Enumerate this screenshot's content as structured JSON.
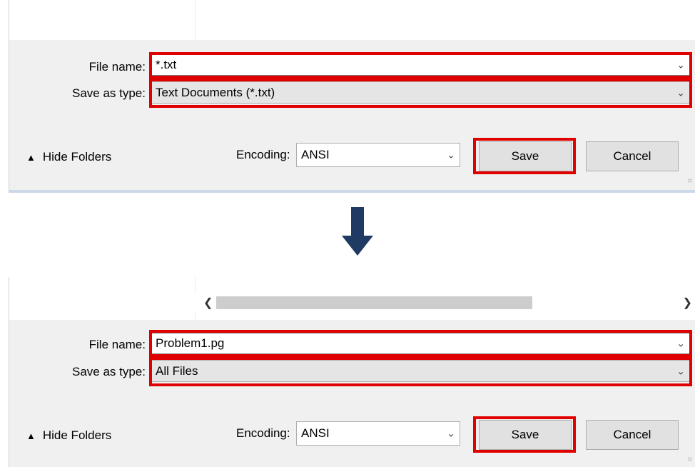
{
  "panels": [
    {
      "file_name_label": "File name:",
      "file_name_value": "*.txt",
      "save_as_type_label": "Save as type:",
      "save_as_type_value": "Text Documents (*.txt)",
      "hide_folders_label": "Hide Folders",
      "encoding_label": "Encoding:",
      "encoding_value": "ANSI",
      "save_label": "Save",
      "cancel_label": "Cancel"
    },
    {
      "file_name_label": "File name:",
      "file_name_value": "Problem1.pg",
      "save_as_type_label": "Save as type:",
      "save_as_type_value": "All Files",
      "hide_folders_label": "Hide Folders",
      "encoding_label": "Encoding:",
      "encoding_value": "ANSI",
      "save_label": "Save",
      "cancel_label": "Cancel"
    }
  ],
  "colors": {
    "highlight": "#e00000",
    "arrow": "#1f3a63"
  },
  "icons": {
    "transition": "arrow-down-icon",
    "dropdown": "chevron-down-icon",
    "collapse": "caret-up-icon"
  }
}
